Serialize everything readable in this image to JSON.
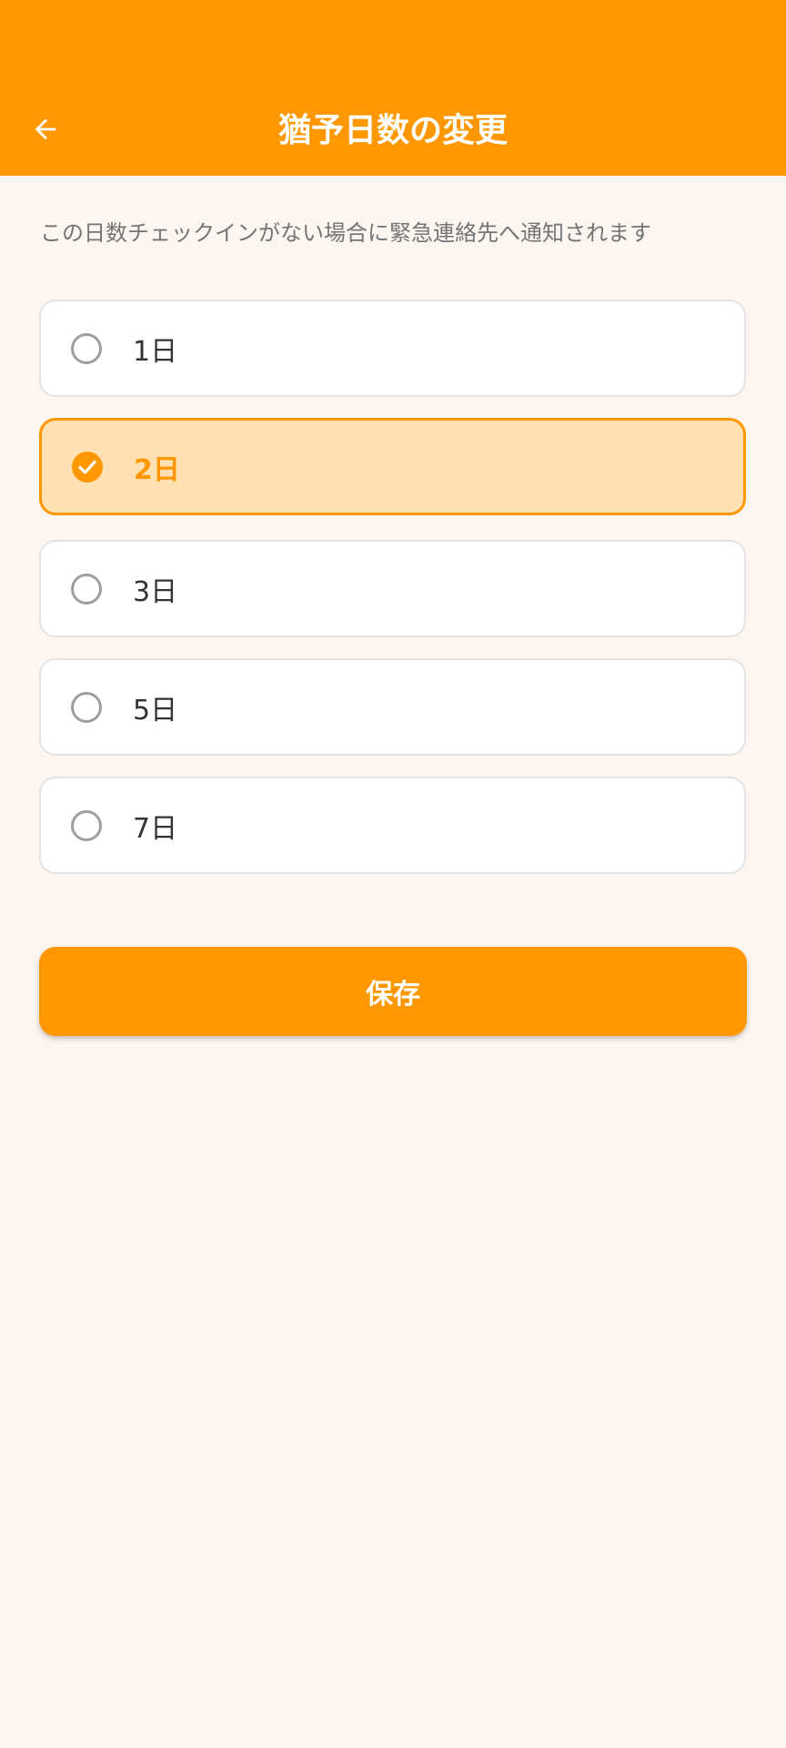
{
  "app_bar": {
    "title": "猶予日数の変更",
    "back_icon": "arrow-left-icon",
    "background_color": "#ff9800"
  },
  "description": "この日数チェックインがない場合に緊急連絡先へ通知されます",
  "options": [
    {
      "label": "1日",
      "selected": false
    },
    {
      "label": "2日",
      "selected": true
    },
    {
      "label": "3日",
      "selected": false
    },
    {
      "label": "5日",
      "selected": false
    },
    {
      "label": "7日",
      "selected": false
    }
  ],
  "save_button": {
    "label": "保存"
  },
  "colors": {
    "accent": "#ff9800",
    "selected_background": "#ffe0b2",
    "page_background": "#fdf6f0"
  }
}
